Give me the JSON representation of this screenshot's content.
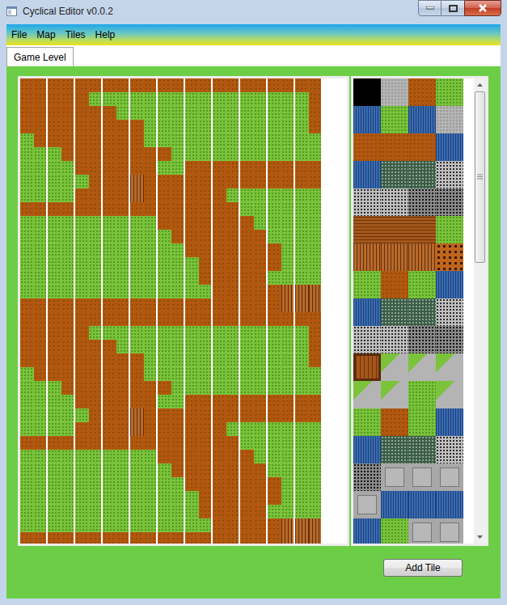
{
  "window": {
    "title": "Cyclical Editor v0.0.2"
  },
  "menu": [
    "File",
    "Map",
    "Tiles",
    "Help"
  ],
  "tabs": [
    {
      "label": "Game Level",
      "selected": true
    }
  ],
  "map": {
    "rows": [
      [
        0,
        0,
        0,
        0,
        0,
        0,
        0,
        0,
        0,
        0,
        0,
        0,
        0,
        0,
        0,
        0,
        0,
        0,
        0,
        0,
        0,
        0
      ],
      [
        0,
        0,
        0,
        0,
        0,
        1,
        1,
        1,
        1,
        1,
        1,
        1,
        1,
        1,
        1,
        1,
        1,
        1,
        1,
        1,
        1,
        0
      ],
      [
        0,
        0,
        0,
        0,
        0,
        0,
        0,
        1,
        1,
        1,
        1,
        1,
        1,
        1,
        1,
        1,
        1,
        1,
        1,
        1,
        1,
        0
      ],
      [
        0,
        0,
        0,
        0,
        0,
        0,
        0,
        0,
        0,
        1,
        1,
        1,
        1,
        1,
        1,
        1,
        1,
        1,
        1,
        1,
        1,
        0
      ],
      [
        1,
        0,
        0,
        0,
        0,
        0,
        0,
        0,
        0,
        1,
        1,
        1,
        1,
        1,
        1,
        1,
        1,
        1,
        1,
        1,
        1,
        1
      ],
      [
        1,
        1,
        1,
        0,
        0,
        0,
        0,
        0,
        0,
        0,
        0,
        1,
        1,
        1,
        1,
        1,
        1,
        1,
        1,
        1,
        1,
        1
      ],
      [
        1,
        1,
        1,
        1,
        0,
        0,
        0,
        0,
        0,
        0,
        1,
        1,
        0,
        0,
        0,
        0,
        0,
        0,
        0,
        0,
        0,
        0
      ],
      [
        1,
        1,
        1,
        1,
        1,
        0,
        0,
        0,
        2,
        0,
        0,
        0,
        0,
        0,
        0,
        0,
        0,
        0,
        0,
        0,
        0,
        0
      ],
      [
        1,
        1,
        1,
        1,
        0,
        0,
        0,
        0,
        2,
        0,
        0,
        0,
        0,
        0,
        0,
        1,
        1,
        1,
        1,
        1,
        1,
        1
      ],
      [
        0,
        0,
        0,
        0,
        0,
        0,
        0,
        0,
        0,
        0,
        0,
        0,
        0,
        0,
        0,
        0,
        1,
        1,
        1,
        1,
        1,
        1
      ],
      [
        1,
        1,
        1,
        1,
        1,
        1,
        1,
        1,
        1,
        1,
        0,
        0,
        0,
        0,
        0,
        0,
        0,
        1,
        1,
        1,
        1,
        1
      ],
      [
        1,
        1,
        1,
        1,
        1,
        1,
        1,
        1,
        1,
        1,
        1,
        0,
        0,
        0,
        0,
        0,
        0,
        0,
        1,
        1,
        1,
        1
      ],
      [
        1,
        1,
        1,
        1,
        1,
        1,
        1,
        1,
        1,
        1,
        1,
        1,
        0,
        0,
        0,
        0,
        0,
        0,
        0,
        1,
        1,
        1
      ],
      [
        1,
        1,
        1,
        1,
        1,
        1,
        1,
        1,
        1,
        1,
        1,
        1,
        1,
        0,
        0,
        0,
        0,
        0,
        0,
        1,
        1,
        1
      ],
      [
        1,
        1,
        1,
        1,
        1,
        1,
        1,
        1,
        1,
        1,
        1,
        1,
        1,
        0,
        0,
        0,
        0,
        0,
        1,
        1,
        1,
        1
      ],
      [
        1,
        1,
        1,
        1,
        1,
        1,
        1,
        1,
        1,
        1,
        1,
        1,
        1,
        1,
        0,
        0,
        0,
        0,
        0,
        2,
        2,
        2
      ],
      [
        0,
        0,
        0,
        0,
        0,
        0,
        0,
        0,
        0,
        0,
        0,
        0,
        0,
        0,
        0,
        0,
        0,
        0,
        0,
        2,
        2,
        2
      ],
      [
        0,
        0,
        0,
        0,
        0,
        0,
        0,
        0,
        0,
        0,
        0,
        0,
        0,
        0,
        0,
        0,
        0,
        0,
        0,
        0,
        0,
        0
      ],
      [
        0,
        0,
        0,
        0,
        0,
        1,
        1,
        1,
        1,
        1,
        1,
        1,
        1,
        1,
        1,
        1,
        1,
        1,
        1,
        1,
        1,
        0
      ],
      [
        0,
        0,
        0,
        0,
        0,
        0,
        0,
        1,
        1,
        1,
        1,
        1,
        1,
        1,
        1,
        1,
        1,
        1,
        1,
        1,
        1,
        0
      ],
      [
        0,
        0,
        0,
        0,
        0,
        0,
        0,
        0,
        0,
        1,
        1,
        1,
        1,
        1,
        1,
        1,
        1,
        1,
        1,
        1,
        1,
        0
      ],
      [
        1,
        0,
        0,
        0,
        0,
        0,
        0,
        0,
        0,
        1,
        1,
        1,
        1,
        1,
        1,
        1,
        1,
        1,
        1,
        1,
        1,
        1
      ],
      [
        1,
        1,
        1,
        0,
        0,
        0,
        0,
        0,
        0,
        0,
        0,
        1,
        1,
        1,
        1,
        1,
        1,
        1,
        1,
        1,
        1,
        1
      ],
      [
        1,
        1,
        1,
        1,
        0,
        0,
        0,
        0,
        0,
        0,
        1,
        1,
        0,
        0,
        0,
        0,
        0,
        0,
        0,
        0,
        0,
        0
      ],
      [
        1,
        1,
        1,
        1,
        1,
        0,
        0,
        0,
        2,
        0,
        0,
        0,
        0,
        0,
        0,
        0,
        0,
        0,
        0,
        0,
        0,
        0
      ],
      [
        1,
        1,
        1,
        1,
        0,
        0,
        0,
        0,
        2,
        0,
        0,
        0,
        0,
        0,
        0,
        1,
        1,
        1,
        1,
        1,
        1,
        1
      ],
      [
        0,
        0,
        0,
        0,
        0,
        0,
        0,
        0,
        0,
        0,
        0,
        0,
        0,
        0,
        0,
        0,
        1,
        1,
        1,
        1,
        1,
        1
      ],
      [
        1,
        1,
        1,
        1,
        1,
        1,
        1,
        1,
        1,
        1,
        0,
        0,
        0,
        0,
        0,
        0,
        0,
        1,
        1,
        1,
        1,
        1
      ],
      [
        1,
        1,
        1,
        1,
        1,
        1,
        1,
        1,
        1,
        1,
        1,
        0,
        0,
        0,
        0,
        0,
        0,
        0,
        1,
        1,
        1,
        1
      ],
      [
        1,
        1,
        1,
        1,
        1,
        1,
        1,
        1,
        1,
        1,
        1,
        1,
        0,
        0,
        0,
        0,
        0,
        0,
        0,
        1,
        1,
        1
      ],
      [
        1,
        1,
        1,
        1,
        1,
        1,
        1,
        1,
        1,
        1,
        1,
        1,
        1,
        0,
        0,
        0,
        0,
        0,
        0,
        1,
        1,
        1
      ],
      [
        1,
        1,
        1,
        1,
        1,
        1,
        1,
        1,
        1,
        1,
        1,
        1,
        1,
        0,
        0,
        0,
        0,
        0,
        1,
        1,
        1,
        1
      ],
      [
        1,
        1,
        1,
        1,
        1,
        1,
        1,
        1,
        1,
        1,
        1,
        1,
        1,
        1,
        0,
        0,
        0,
        0,
        0,
        2,
        2,
        2
      ],
      [
        0,
        0,
        0,
        0,
        0,
        0,
        0,
        0,
        0,
        0,
        0,
        0,
        0,
        0,
        0,
        0,
        0,
        0,
        0,
        2,
        2,
        2
      ]
    ]
  },
  "palette": {
    "rows": [
      [
        "black",
        "stone",
        "dirt",
        "grass"
      ],
      [
        "water",
        "grass",
        "water",
        "stone"
      ],
      [
        "dirt",
        "dirt",
        "dirt",
        "water"
      ],
      [
        "water",
        "mossy",
        "mossy",
        "gravel"
      ],
      [
        "gravel",
        "gravel",
        "darkgravel",
        "darkgravel"
      ],
      [
        "wood",
        "wood",
        "wood",
        "grass"
      ],
      [
        "bridge",
        "bridge",
        "bridge",
        "rock"
      ],
      [
        "grass",
        "dirt",
        "grass",
        "water"
      ],
      [
        "water",
        "mossy",
        "mossy",
        "gravel"
      ],
      [
        "gravel",
        "gravel",
        "darkgravel",
        "darkgravel"
      ],
      [
        "crate",
        "road",
        "road",
        "road"
      ],
      [
        "road",
        "road",
        "grass",
        "road"
      ],
      [
        "grass",
        "dirt",
        "grass",
        "water"
      ],
      [
        "water",
        "mossy",
        "mossy",
        "gravel"
      ],
      [
        "darkgravel",
        "slab",
        "slab",
        "slab"
      ],
      [
        "slab",
        "water",
        "water",
        "water"
      ],
      [
        "water",
        "grass",
        "slab",
        "slab"
      ]
    ],
    "scrollbar": {
      "level": 0.39
    }
  },
  "buttons": [
    "Add Tile"
  ]
}
